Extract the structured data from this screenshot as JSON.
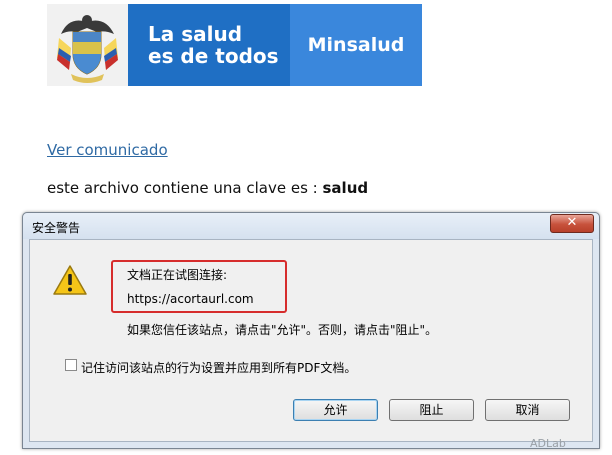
{
  "banner": {
    "line1": "La salud",
    "line2": "es de todos",
    "brand": "Minsalud",
    "seal_icon": "colombia-coat-of-arms",
    "colors": {
      "mid": "#1f6fc4",
      "right": "#3a87dc"
    }
  },
  "email": {
    "link_text": "Ver comunicado",
    "body_prefix": "este archivo contiene una clave es : ",
    "body_key": "salud"
  },
  "dialog": {
    "title": "安全警告",
    "close_label": "✕",
    "message_line1": "文档正在试图连接:",
    "url": "https://acortaurl.com",
    "message_line2": "如果您信任该站点，请点击\"允许\"。否则，请点击\"阻止\"。",
    "checkbox_label": "记住访问该站点的行为设置并应用到所有PDF文档。",
    "checkbox_checked": false,
    "buttons": {
      "allow": "允许",
      "block": "阻止",
      "cancel": "取消"
    },
    "warning_icon": "warning-icon",
    "highlight_color": "#d62c2c"
  },
  "watermark": "ADLab"
}
